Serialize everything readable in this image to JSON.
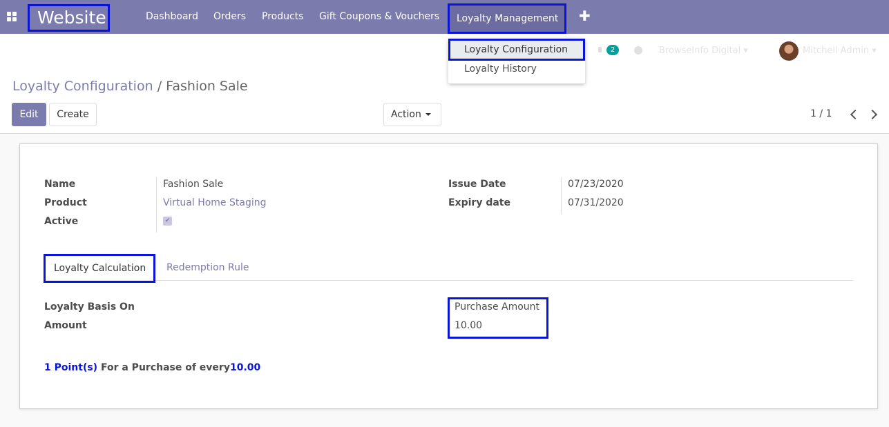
{
  "nav": {
    "brand": "Website",
    "menu": [
      "Dashboard",
      "Orders",
      "Products",
      "Gift Coupons & Vouchers"
    ],
    "active_menu": "Loyalty Management",
    "accent": "#7c7bad",
    "highlight": "#0a14d8"
  },
  "systray": {
    "chat_count": "2",
    "company": "BrowseInfo Digital",
    "user": "Mitchell Admin"
  },
  "dropdown": {
    "items": [
      "Loyalty Configuration",
      "Loyalty History"
    ]
  },
  "breadcrumb": {
    "parent": "Loyalty Configuration",
    "separator": "/",
    "current": "Fashion Sale"
  },
  "buttons": {
    "edit": "Edit",
    "create": "Create",
    "action": "Action"
  },
  "pager": "1 / 1",
  "form": {
    "name_label": "Name",
    "name_value": "Fashion Sale",
    "product_label": "Product",
    "product_value": "Virtual Home Staging",
    "active_label": "Active",
    "active_value": true,
    "issue_label": "Issue Date",
    "issue_value": "07/23/2020",
    "expiry_label": "Expiry date",
    "expiry_value": "07/31/2020"
  },
  "tabs": [
    "Loyalty Calculation",
    "Redemption Rule"
  ],
  "calc": {
    "basis_label": "Loyalty Basis On",
    "basis_value": "Purchase Amount",
    "amount_label": "Amount",
    "amount_value": "10.00",
    "points_prefix": "1 Point(s)",
    "points_mid": " For a Purchase of every",
    "points_value": "10.00"
  }
}
